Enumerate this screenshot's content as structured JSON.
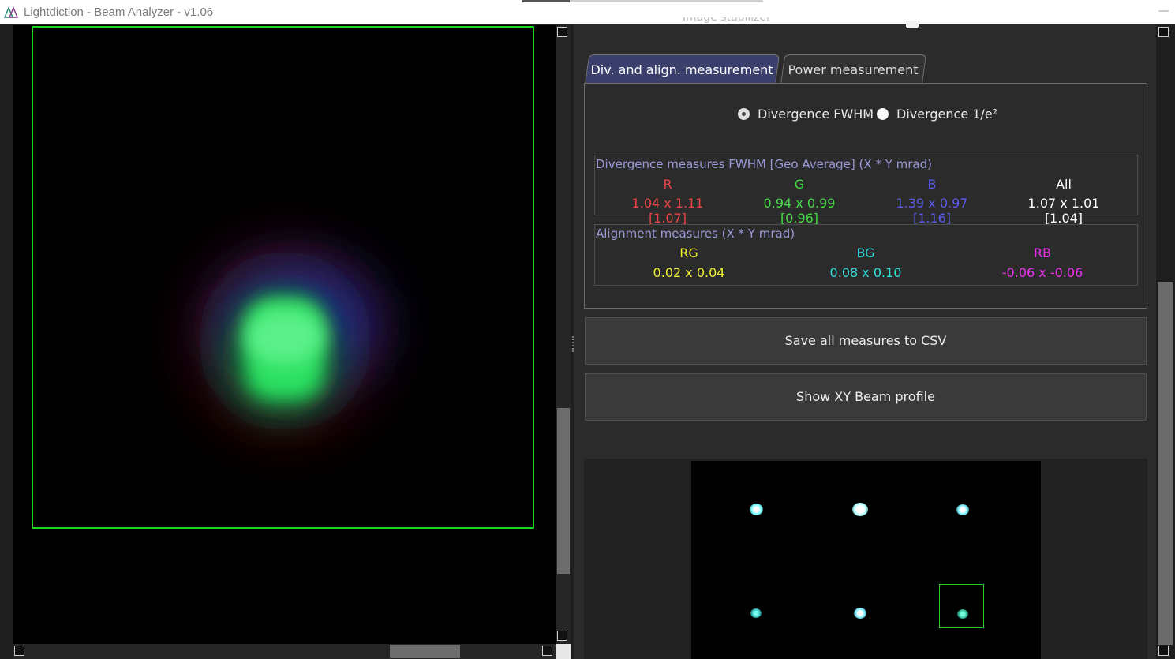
{
  "window": {
    "title": "Lightdiction - Beam Analyzer - v1.06",
    "minimize_glyph": "—"
  },
  "stabilizer": {
    "label": "Image stabilizer"
  },
  "tabs": [
    {
      "label": "Div. and align. measurement",
      "active": true
    },
    {
      "label": "Power measurement",
      "active": false
    }
  ],
  "divergence_mode": {
    "options": [
      "Divergence FWHM",
      "Divergence 1/e²"
    ],
    "selected": "Divergence FWHM"
  },
  "divergence": {
    "title": "Divergence measures FWHM [Geo Average] (X * Y mrad)",
    "columns": [
      {
        "label": "R",
        "value": "1.04 x 1.11 [1.07]",
        "color": "#ee4444"
      },
      {
        "label": "G",
        "value": "0.94 x 0.99 [0.96]",
        "color": "#44dd44"
      },
      {
        "label": "B",
        "value": "1.39 x 0.97 [1.16]",
        "color": "#5a5aee"
      },
      {
        "label": "All",
        "value": "1.07 x 1.01 [1.04]",
        "color": "#ffffff"
      }
    ]
  },
  "alignment": {
    "title": "Alignment measures (X * Y mrad)",
    "columns": [
      {
        "label": "RG",
        "value": "0.02 x 0.04",
        "color": "#eeee33"
      },
      {
        "label": "BG",
        "value": "0.08 x 0.10",
        "color": "#33dddd"
      },
      {
        "label": "RB",
        "value": "-0.06 x -0.06",
        "color": "#ee33ee"
      }
    ]
  },
  "buttons": {
    "save_csv": "Save all measures to CSV",
    "show_profile": "Show XY Beam profile"
  },
  "colors": {
    "roi_border": "#1ed81e",
    "active_tab": "#3b3f6c",
    "group_title": "#9a9ad8"
  }
}
